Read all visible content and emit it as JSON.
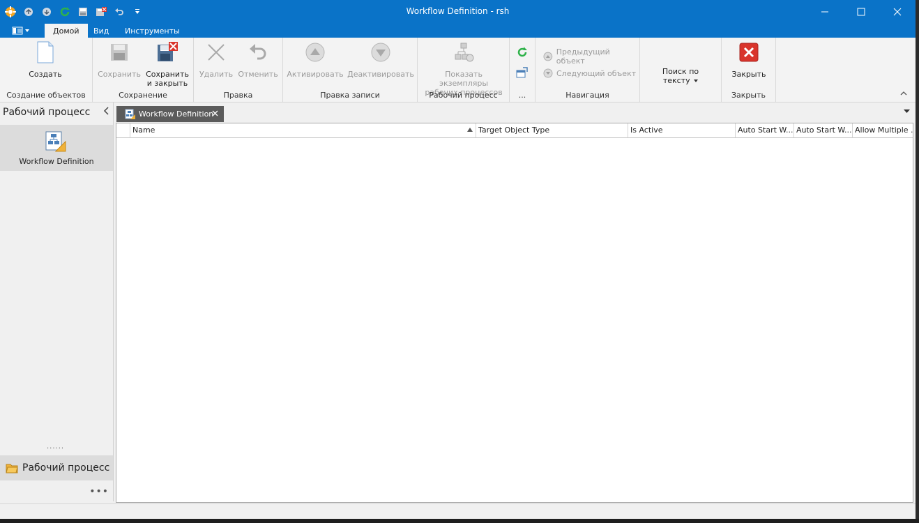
{
  "window": {
    "title": "Workflow Definition - rsh"
  },
  "quick_access": {
    "icons": [
      "app-logo-icon",
      "back-arrow-icon",
      "forward-arrow-icon",
      "refresh-icon",
      "save-icon",
      "save-close-icon",
      "undo-icon",
      "customize-dropdown-icon"
    ]
  },
  "ribbon_tabs": [
    "Домой",
    "Вид",
    "Инструменты"
  ],
  "ribbon": {
    "groups": {
      "create": {
        "label": "Создание объектов",
        "create": "Создать"
      },
      "save": {
        "label": "Сохранение",
        "save": "Сохранить",
        "save_close": "Сохранить\nи закрыть"
      },
      "edit": {
        "label": "Правка",
        "delete": "Удалить",
        "cancel": "Отменить"
      },
      "record": {
        "label": "Правка записи",
        "activate": "Активировать",
        "deactivate": "Деактивировать"
      },
      "workflow": {
        "label": "Рабочий процесс",
        "show_instances": "Показать экземпляры\nрабочих процессов"
      },
      "more": {
        "label": "..."
      },
      "navigation": {
        "label": "Навигация",
        "previous": "Предыдущий объект",
        "next": "Следующий объект"
      },
      "search": {
        "label": "Поиск по\nтексту"
      },
      "close": {
        "label": "Закрыть",
        "close": "Закрыть"
      }
    }
  },
  "leftnav": {
    "header": "Рабочий процесс",
    "item": "Workflow Definition",
    "group": "Рабочий процесс",
    "splitter": "......",
    "more": "•••"
  },
  "document": {
    "tab_title": "Workflow Definition",
    "columns": [
      "Name",
      "Target Object Type",
      "Is Active",
      "Auto Start W...",
      "Auto Start W...",
      "Allow Multiple ..."
    ]
  },
  "colors": {
    "accent": "#0a73c8",
    "ribbon_bg": "#f3f3f3",
    "close_red": "#d9342b"
  }
}
